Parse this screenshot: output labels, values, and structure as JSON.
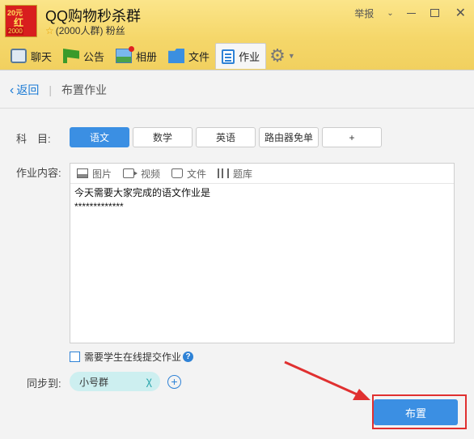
{
  "window": {
    "group_name": "QQ购物秒杀群",
    "group_sub": "(2000人群) 粉丝",
    "avatar": {
      "top": "20元",
      "middle": "红",
      "bottom": "2000"
    },
    "report_label": "举报"
  },
  "tabs": [
    {
      "label": "聊天",
      "icon": "chat-icon"
    },
    {
      "label": "公告",
      "icon": "notice-flag-icon"
    },
    {
      "label": "相册",
      "icon": "album-icon"
    },
    {
      "label": "文件",
      "icon": "folder-icon"
    },
    {
      "label": "作业",
      "icon": "homework-icon",
      "active": true
    }
  ],
  "breadcrumb": {
    "back": "返回",
    "title": "布置作业"
  },
  "form": {
    "subject_label": "科　目:",
    "subjects": [
      "语文",
      "数学",
      "英语",
      "路由器免单",
      "+"
    ],
    "selected_subject": "语文",
    "content_label": "作业内容:",
    "toolbar": [
      "图片",
      "视频",
      "文件",
      "题库"
    ],
    "content_text": "今天需要大家完成的语文作业是\n*************",
    "online_submit_label": "需要学生在线提交作业",
    "online_submit_checked": false,
    "sync_label": "同步到:",
    "sync_tag": "小号群",
    "submit_label": "布置"
  },
  "colors": {
    "accent": "#3b8fe3",
    "highlight_box": "#e03030"
  }
}
